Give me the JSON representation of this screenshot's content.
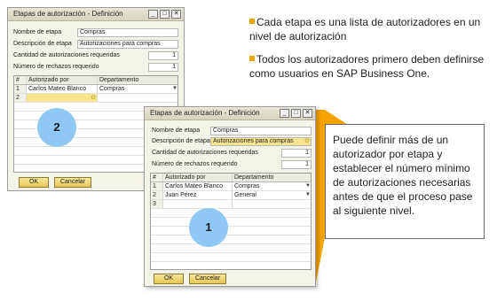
{
  "brand_colors": {
    "accent": "#f4a300",
    "highlight": "#f5e58c",
    "circle": "#8fc8f3"
  },
  "window1": {
    "title": "Etapas de autorización - Definición",
    "controls": {
      "minimize": "_",
      "maximize": "□",
      "close": "✕"
    },
    "fields": {
      "nombre_label": "Nombre de etapa",
      "nombre_value": "Compras",
      "descripcion_label": "Descripción de etapa",
      "descripcion_value": "Autorizaciones para compras",
      "cantidad_label": "Cantidad de autorizaciones requeridas",
      "cantidad_value": "1",
      "rechazos_label": "Número de rechazos requerido",
      "rechazos_value": "1"
    },
    "table": {
      "headers": [
        "#",
        "Autorizado por",
        "Departamento"
      ],
      "rows": [
        {
          "num": "1",
          "user": "Carlos Mateo Blanco",
          "dept": "Compras"
        },
        {
          "num": "2",
          "user": "",
          "dept": ""
        }
      ]
    },
    "ok": "OK",
    "cancel": "Cancelar",
    "marker": "2"
  },
  "window2": {
    "title": "Etapas de autorización - Definición",
    "controls": {
      "minimize": "_",
      "maximize": "□",
      "close": "✕"
    },
    "fields": {
      "nombre_label": "Nombre de etapa",
      "nombre_value": "Compras",
      "descripcion_label": "Descripción de etapa",
      "descripcion_value": "Autorizaciones para compras",
      "cantidad_label": "Cantidad de autorizaciones requeridas",
      "cantidad_value": "1",
      "rechazos_label": "Número de rechazos requerido",
      "rechazos_value": "1"
    },
    "table": {
      "headers": [
        "#",
        "Autorizado por",
        "Departamento"
      ],
      "rows": [
        {
          "num": "1",
          "user": "Carlos Mateo Blanco",
          "dept": "Compras"
        },
        {
          "num": "2",
          "user": "Juan Pérez",
          "dept": "General"
        },
        {
          "num": "3",
          "user": "",
          "dept": ""
        }
      ]
    },
    "ok": "OK",
    "cancel": "Cancelar",
    "marker": "1"
  },
  "bullets": [
    "Cada etapa es una lista de autorizadores en un nivel de autorización",
    "Todos los autorizadores primero deben definirse como usuarios en SAP Business One."
  ],
  "callout": "Puede definir más de un autorizador por etapa y establecer el número mínimo de autorizaciones necesarias antes de que el proceso pase al siguiente nivel."
}
